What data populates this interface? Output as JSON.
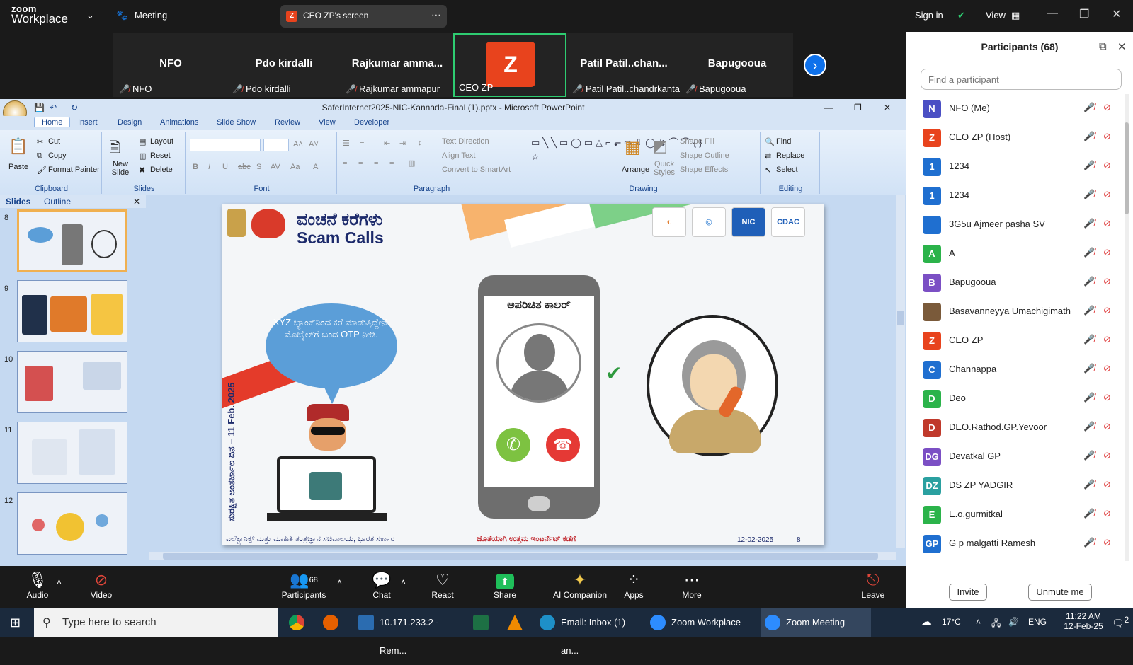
{
  "topbar": {
    "logo_line1": "zoom",
    "logo_line2": "Workplace",
    "meeting_label": "Meeting",
    "share_label": "CEO ZP's screen",
    "sign_in": "Sign in",
    "view": "View"
  },
  "gallery": {
    "tiles": [
      {
        "name": "NFO",
        "label": "NFO"
      },
      {
        "name": "Pdo kirdalli",
        "label": "Pdo kirdalli"
      },
      {
        "name": "Rajkumar  amma...",
        "label": "Rajkumar ammapur"
      },
      {
        "name": "Z",
        "label": "CEO ZP"
      },
      {
        "name": "Patil  Patil..chan...",
        "label": "Patil Patil..chandrkanta"
      },
      {
        "name": "Bapugooua",
        "label": "Bapugooua"
      }
    ]
  },
  "participants": {
    "title": "Participants (68)",
    "search_placeholder": "Find a participant",
    "list": [
      {
        "initial": "N",
        "name": "NFO (Me)",
        "color": "#4a4fc4"
      },
      {
        "initial": "Z",
        "name": "CEO ZP (Host)",
        "color": "#e8431d"
      },
      {
        "initial": "1",
        "name": "1234",
        "color": "#1f6fd0"
      },
      {
        "initial": "1",
        "name": "1234",
        "color": "#1f6fd0"
      },
      {
        "initial": "",
        "name": "3G5u Ajmeer pasha SV",
        "color": "#1f6fd0"
      },
      {
        "initial": "A",
        "name": "A",
        "color": "#2bb34a"
      },
      {
        "initial": "B",
        "name": "Bapugooua",
        "color": "#7b4fc4"
      },
      {
        "initial": "",
        "name": "Basavanneyya Umachigimath",
        "color": "#7a5a3a"
      },
      {
        "initial": "Z",
        "name": "CEO ZP",
        "color": "#e8431d"
      },
      {
        "initial": "C",
        "name": "Channappa",
        "color": "#1f6fd0"
      },
      {
        "initial": "D",
        "name": "Deo",
        "color": "#2bb34a"
      },
      {
        "initial": "D",
        "name": "DEO.Rathod.GP.Yevoor",
        "color": "#c0392b"
      },
      {
        "initial": "DG",
        "name": "Devatkal GP",
        "color": "#7b4fc4"
      },
      {
        "initial": "DZ",
        "name": "DS ZP YADGIR",
        "color": "#2aa0a0"
      },
      {
        "initial": "E",
        "name": "E.o.gurmitkal",
        "color": "#2bb34a"
      },
      {
        "initial": "GP",
        "name": "G p malgatti Ramesh",
        "color": "#1f6fd0"
      }
    ],
    "invite": "Invite",
    "unmute_me": "Unmute me"
  },
  "ppt": {
    "title": "SaferInternet2025-NIC-Kannada-Final (1).pptx - Microsoft PowerPoint",
    "tabs": [
      "Home",
      "Insert",
      "Design",
      "Animations",
      "Slide Show",
      "Review",
      "View",
      "Developer"
    ],
    "clipboard": {
      "paste": "Paste",
      "cut": "Cut",
      "copy": "Copy",
      "format_painter": "Format Painter",
      "label": "Clipboard"
    },
    "slides_group": {
      "new_slide": "New Slide",
      "layout": "Layout",
      "reset": "Reset",
      "delete": "Delete",
      "label": "Slides"
    },
    "font_label": "Font",
    "paragraph": {
      "text_direction": "Text Direction",
      "align_text": "Align Text",
      "convert": "Convert to SmartArt",
      "label": "Paragraph"
    },
    "drawing": {
      "arrange": "Arrange",
      "quick_styles": "Quick Styles",
      "shape_fill": "Shape Fill",
      "shape_outline": "Shape Outline",
      "shape_effects": "Shape Effects",
      "label": "Drawing"
    },
    "editing": {
      "find": "Find",
      "replace": "Replace",
      "select": "Select",
      "label": "Editing"
    },
    "pane": {
      "slides_tab": "Slides",
      "outline_tab": "Outline"
    },
    "thumb_numbers": [
      "8",
      "9",
      "10",
      "11",
      "12"
    ]
  },
  "slide": {
    "title_kn": "ವಂಚನೆ ಕರೆಗಳು",
    "title_en": "Scam Calls",
    "bubble": "XYZ ಬ್ಯಾಂಕ್‌ನಿಂದ ಕರೆ ಮಾಡುತ್ತಿದ್ದೇನೆ. ಮೊಬೈಲ್‌ಗೆ ಬಂದ OTP ನೀಡಿ.",
    "caller_label": "ಅಪರಿಚಿತ ಕಾಲರ್",
    "side_text": "ಸುರಕ್ಷಿತ ಅಂತರ್ಜಾಲ ದಿನ – 11 Feb. 2025",
    "footer_left": "ಎಲೆಕ್ಟ್ರಾನಿಕ್ಸ್ ಮತ್ತು ಮಾಹಿತಿ ತಂತ್ರಜ್ಞಾನ ಸಚಿವಾಲಯ, ಭಾರತ ಸರ್ಕಾರ",
    "footer_center": "ಜೊತೆಯಾಗಿ ಉತ್ತಮ ಇಂಟರ್ನೆಟ್ ಕಡೆಗೆ",
    "footer_date": "12-02-2025",
    "footer_num": "8",
    "logo_nic": "NIC",
    "logo_cdac": "CDAC"
  },
  "zoombar": {
    "audio": "Audio",
    "video": "Video",
    "participants": "Participants",
    "participants_count": "68",
    "chat": "Chat",
    "react": "React",
    "share": "Share",
    "ai": "AI Companion",
    "apps": "Apps",
    "more": "More",
    "leave": "Leave"
  },
  "taskbar": {
    "search": "Type here to search",
    "apps": [
      "10.171.233.2 - Rem...",
      "Email: Inbox (1) an...",
      "Zoom Workplace",
      "Zoom Meeting"
    ],
    "temp": "17°C",
    "lang": "ENG",
    "time": "11:22 AM",
    "date": "12-Feb-25",
    "notif": "2"
  }
}
